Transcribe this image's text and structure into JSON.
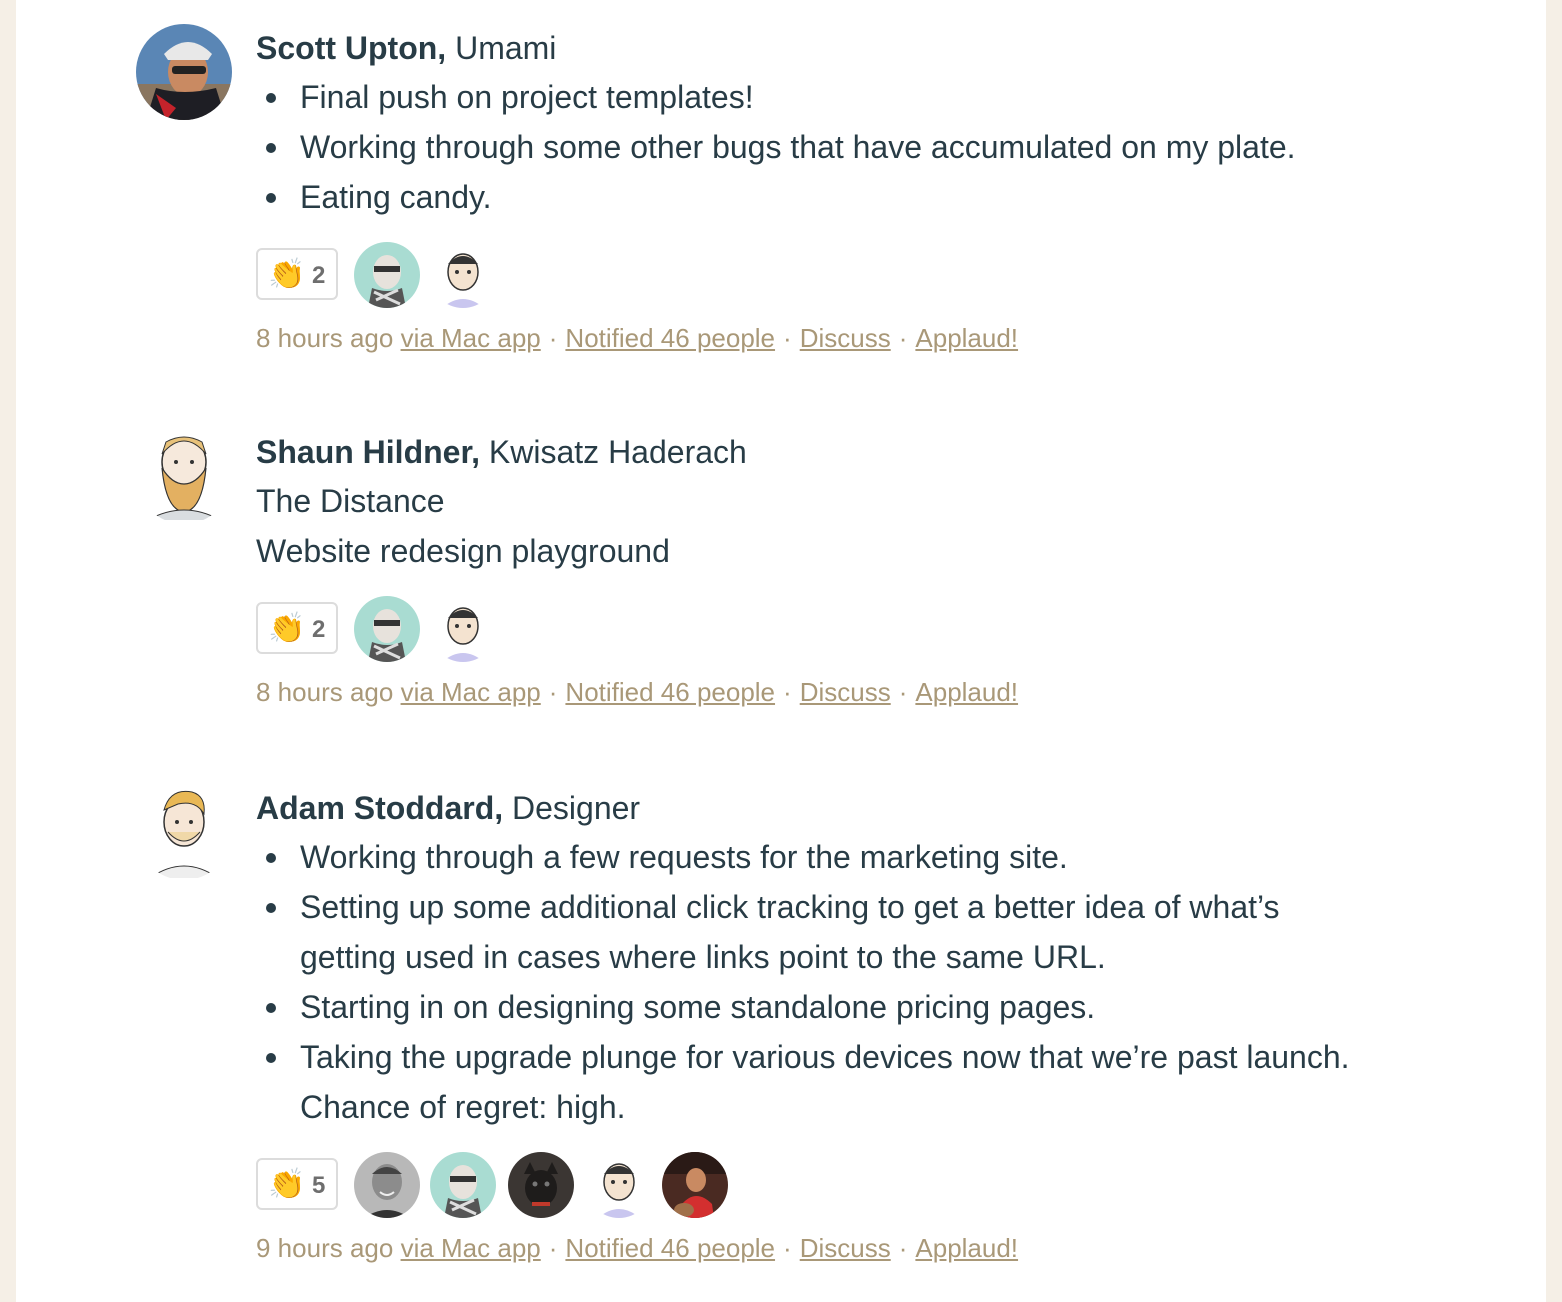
{
  "posts": [
    {
      "author": "Scott Upton,",
      "role": " Umami",
      "bullets": [
        "Final push on project templates!",
        "Working through some other bugs that have accumulated on my plate.",
        "Eating candy."
      ],
      "applause_count": "2",
      "time": "8 hours ago",
      "via": "via Mac app",
      "notified": "Notified 46 people",
      "discuss": "Discuss",
      "applaud": "Applaud!"
    },
    {
      "author": "Shaun Hildner,",
      "role": " Kwisatz Haderach",
      "lines": [
        "The Distance",
        "Website redesign playground"
      ],
      "applause_count": "2",
      "time": "8 hours ago",
      "via": "via Mac app",
      "notified": "Notified 46 people",
      "discuss": "Discuss",
      "applaud": "Applaud!"
    },
    {
      "author": "Adam Stoddard,",
      "role": " Designer",
      "bullets": [
        "Working through a few requests for the marketing site.",
        "Setting up some additional click tracking to get a better idea of what’s getting used in cases where links point to the same URL.",
        "Starting in on designing some standalone pricing pages.",
        "Taking the upgrade plunge for various devices now that we’re past launch. Chance of regret: high."
      ],
      "applause_count": "5",
      "time": "9 hours ago",
      "via": "via Mac app",
      "notified": "Notified 46 people",
      "discuss": "Discuss",
      "applaud": "Applaud!"
    }
  ],
  "separator": "·",
  "icons": {
    "applause": "clapping-hands-icon"
  },
  "colors": {
    "background": "#f5efe6",
    "text": "#283c46",
    "meta": "#a99878"
  }
}
